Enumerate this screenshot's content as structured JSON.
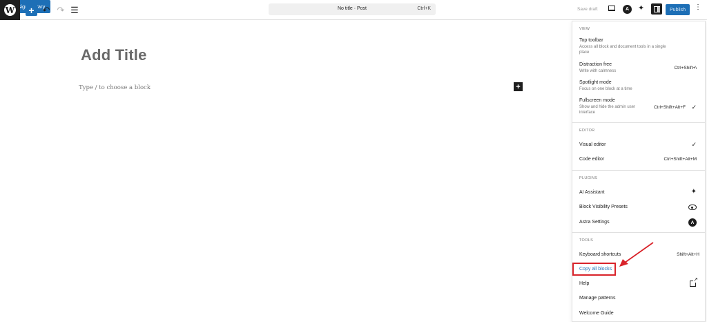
{
  "toolbar": {
    "logo_letter": "W",
    "add_symbol": "+",
    "undo_symbol": "↶",
    "redo_symbol": "↷",
    "listview_symbol": "☰",
    "design_library_label": "Design Library",
    "command_title": "No title · Post",
    "command_shortcut": "Ctrl+K",
    "save_draft_label": "Save draft",
    "astra_letter": "A",
    "ai_symbol": "✦",
    "publish_label": "Publish",
    "more_symbol": "⋮"
  },
  "editor": {
    "title_placeholder": "Add Title",
    "block_placeholder": "Type / to choose a block",
    "add_block_symbol": "+"
  },
  "menu": {
    "view": {
      "section_title": "VIEW",
      "top_toolbar": {
        "label": "Top toolbar",
        "desc": "Access all block and document tools in a single place"
      },
      "distraction_free": {
        "label": "Distraction free",
        "desc": "Write with calmness",
        "shortcut": "Ctrl+Shift+\\"
      },
      "spotlight": {
        "label": "Spotlight mode",
        "desc": "Focus on one block at a time"
      },
      "fullscreen": {
        "label": "Fullscreen mode",
        "desc": "Show and hide the admin user interface",
        "shortcut": "Ctrl+Shift+Alt+F",
        "check": "✓"
      }
    },
    "editor": {
      "section_title": "EDITOR",
      "visual": {
        "label": "Visual editor",
        "check": "✓"
      },
      "code": {
        "label": "Code editor",
        "shortcut": "Ctrl+Shift+Alt+M"
      }
    },
    "plugins": {
      "section_title": "PLUGINS",
      "ai_assistant": {
        "label": "AI Assistant",
        "icon": "✦"
      },
      "block_visibility": {
        "label": "Block Visibility Presets"
      },
      "astra_settings": {
        "label": "Astra Settings",
        "icon": "A"
      }
    },
    "tools": {
      "section_title": "TOOLS",
      "keyboard": {
        "label": "Keyboard shortcuts",
        "shortcut": "Shift+Alt+H"
      },
      "copy_all": {
        "label": "Copy all blocks"
      },
      "help": {
        "label": "Help"
      },
      "patterns": {
        "label": "Manage patterns"
      },
      "welcome": {
        "label": "Welcome Guide"
      }
    }
  },
  "colors": {
    "accent": "#1d6fb6",
    "annotation": "#d9232a"
  }
}
